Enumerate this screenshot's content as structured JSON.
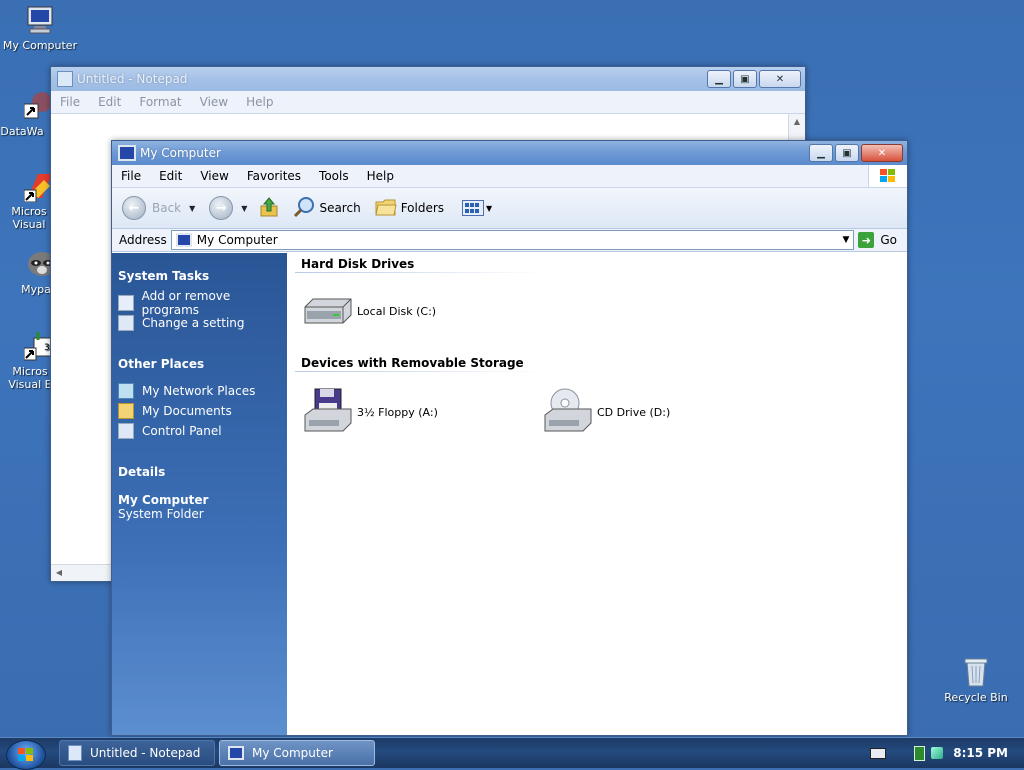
{
  "desktop": {
    "icons": [
      {
        "label": "My Computer",
        "icon": "computer-icon"
      },
      {
        "label": "DataWa",
        "icon": "shortcut-app-icon"
      },
      {
        "label": "Micros Visual",
        "icon": "visual-studio-icon"
      },
      {
        "label": "Mypa",
        "icon": "raccoon-app-icon"
      },
      {
        "label": "Micros Visual E",
        "icon": "visual-basic-icon"
      },
      {
        "label": "Recycle Bin",
        "icon": "recycle-bin-icon"
      }
    ]
  },
  "notepad": {
    "title": "Untitled - Notepad",
    "menu": [
      "File",
      "Edit",
      "Format",
      "View",
      "Help"
    ]
  },
  "explorer": {
    "title": "My Computer",
    "menu": [
      "File",
      "Edit",
      "View",
      "Favorites",
      "Tools",
      "Help"
    ],
    "toolbar": {
      "back": "Back",
      "search": "Search",
      "folders": "Folders"
    },
    "address": {
      "label": "Address",
      "value": "My Computer",
      "go": "Go"
    },
    "sidebar": {
      "system_tasks": {
        "heading": "System Tasks",
        "items": [
          "Add or remove programs",
          "Change a setting"
        ]
      },
      "other_places": {
        "heading": "Other Places",
        "items": [
          "My Network Places",
          "My Documents",
          "Control Panel"
        ]
      },
      "details": {
        "heading": "Details",
        "name": "My Computer",
        "type": "System Folder"
      }
    },
    "groups": {
      "hard_disks": {
        "heading": "Hard Disk Drives",
        "items": [
          {
            "label": "Local Disk (C:)",
            "icon": "hard-disk-icon"
          }
        ]
      },
      "removable": {
        "heading": "Devices with Removable Storage",
        "items": [
          {
            "label": "3½ Floppy (A:)",
            "icon": "floppy-drive-icon"
          },
          {
            "label": "CD Drive (D:)",
            "icon": "cd-drive-icon"
          }
        ]
      }
    }
  },
  "taskbar": {
    "tasks": [
      "Untitled - Notepad",
      "My Computer"
    ],
    "clock": "8:15 PM"
  }
}
